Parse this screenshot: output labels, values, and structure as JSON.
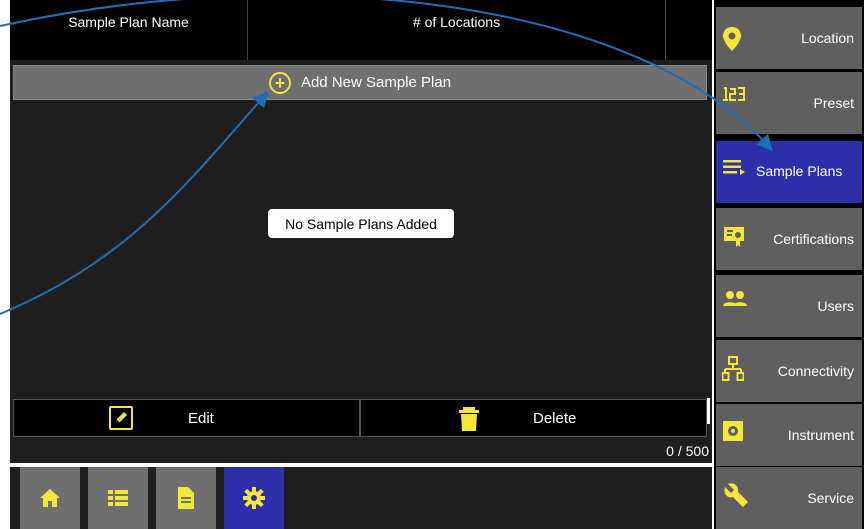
{
  "table": {
    "col_name_header": "Sample Plan Name",
    "col_locations_header": "# of Locations"
  },
  "add_button_label": "Add New Sample Plan",
  "empty_message": "No Sample Plans Added",
  "actions": {
    "edit_label": "Edit",
    "delete_label": "Delete"
  },
  "counter": "0 / 500",
  "bottom_tabs": [
    {
      "icon": "home-icon"
    },
    {
      "icon": "list-icon"
    },
    {
      "icon": "document-icon"
    },
    {
      "icon": "gear-icon",
      "active": true
    }
  ],
  "sidebar": {
    "items": [
      {
        "label": "Location",
        "icon": "location-pin-icon"
      },
      {
        "label": "Preset",
        "icon": "numeric-123-icon"
      },
      {
        "label": "Sample Plans",
        "icon": "sample-plans-icon",
        "active": true
      },
      {
        "label": "Certifications",
        "icon": "certificate-icon"
      },
      {
        "label": "Users",
        "icon": "users-icon"
      },
      {
        "label": "Connectivity",
        "icon": "network-icon"
      },
      {
        "label": "Instrument",
        "icon": "instrument-icon"
      },
      {
        "label": "Service",
        "icon": "wrench-icon"
      }
    ]
  },
  "colors": {
    "accent_yellow": "#f5e63a",
    "active_blue": "#2c2fa8",
    "annotation_arrow": "#1f6fb5"
  }
}
